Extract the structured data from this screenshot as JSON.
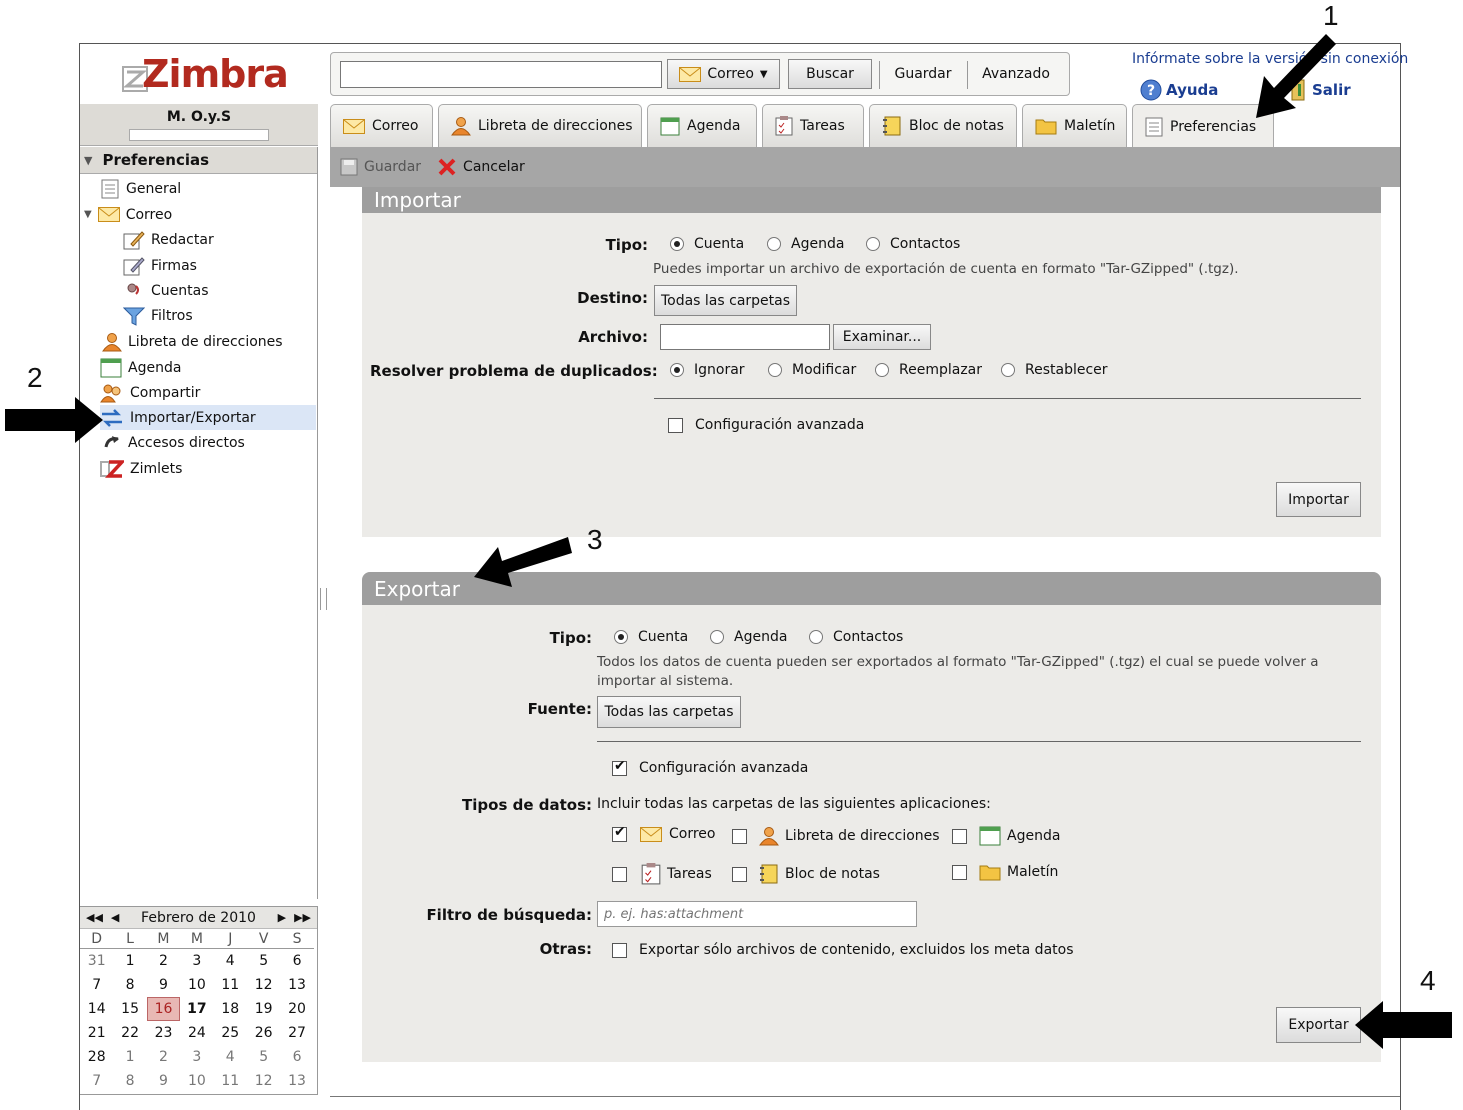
{
  "app": {
    "logo": "Zimbra",
    "user": "M. O.y.S"
  },
  "search": {
    "scope_label": "Correo",
    "search_button": "Buscar",
    "save_button": "Guardar",
    "advanced_button": "Avanzado"
  },
  "top_links": {
    "info": "Infórmate sobre la versión sin conexión",
    "help": "Ayuda",
    "logout": "Salir"
  },
  "tabs": [
    "Correo",
    "Libreta de direcciones",
    "Agenda",
    "Tareas",
    "Bloc de notas",
    "Maletín",
    "Preferencias"
  ],
  "toolbar": {
    "save": "Guardar",
    "cancel": "Cancelar"
  },
  "sidebar": {
    "header": "Preferencias",
    "items": [
      "General",
      "Correo",
      "Redactar",
      "Firmas",
      "Cuentas",
      "Filtros",
      "Libreta de direcciones",
      "Agenda",
      "Compartir",
      "Importar/Exportar",
      "Accesos directos",
      "Zimlets"
    ],
    "selected": "Importar/Exportar"
  },
  "calendar": {
    "month": "Febrero de 2010",
    "days_of_week": [
      "D",
      "L",
      "M",
      "M",
      "J",
      "V",
      "S"
    ],
    "weeks": [
      [
        "31",
        "1",
        "2",
        "3",
        "4",
        "5",
        "6"
      ],
      [
        "7",
        "8",
        "9",
        "10",
        "11",
        "12",
        "13"
      ],
      [
        "14",
        "15",
        "16",
        "17",
        "18",
        "19",
        "20"
      ],
      [
        "21",
        "22",
        "23",
        "24",
        "25",
        "26",
        "27"
      ],
      [
        "28",
        "1",
        "2",
        "3",
        "4",
        "5",
        "6"
      ],
      [
        "7",
        "8",
        "9",
        "10",
        "11",
        "12",
        "13"
      ]
    ],
    "today": "16"
  },
  "import": {
    "title": "Importar",
    "type_label": "Tipo:",
    "type_options": [
      "Cuenta",
      "Agenda",
      "Contactos"
    ],
    "type_hint": "Puedes importar un archivo de exportación de cuenta en formato \"Tar-GZipped\" (.tgz).",
    "dest_label": "Destino:",
    "dest_button": "Todas las carpetas",
    "file_label": "Archivo:",
    "browse_button": "Examinar...",
    "dup_label": "Resolver problema de duplicados:",
    "dup_options": [
      "Ignorar",
      "Modificar",
      "Reemplazar",
      "Restablecer"
    ],
    "advanced": "Configuración avanzada",
    "submit": "Importar"
  },
  "export": {
    "title": "Exportar",
    "type_label": "Tipo:",
    "type_options": [
      "Cuenta",
      "Agenda",
      "Contactos"
    ],
    "type_hint": "Todos los datos de cuenta pueden ser exportados al formato \"Tar-GZipped\" (.tgz) el cual se puede volver a importar al sistema.",
    "source_label": "Fuente:",
    "source_button": "Todas las carpetas",
    "advanced": "Configuración avanzada",
    "data_types_label": "Tipos de datos:",
    "data_types_hint": "Incluir todas las carpetas de las siguientes aplicaciones:",
    "data_types": [
      "Correo",
      "Libreta de direcciones",
      "Agenda",
      "Tareas",
      "Bloc de notas",
      "Maletín"
    ],
    "search_filter_label": "Filtro de búsqueda:",
    "search_filter_placeholder": "p. ej. has:attachment",
    "other_label": "Otras:",
    "other_option": "Exportar sólo archivos de contenido, excluidos los meta datos",
    "submit": "Exportar"
  },
  "annotations": [
    "1",
    "2",
    "3",
    "4"
  ],
  "colors": {
    "logo": "#b22a1f",
    "panel_header": "#9e9e9e",
    "panel_bg": "#ecebe8",
    "selected": "#dbe6f6",
    "link": "#1a3d91"
  }
}
